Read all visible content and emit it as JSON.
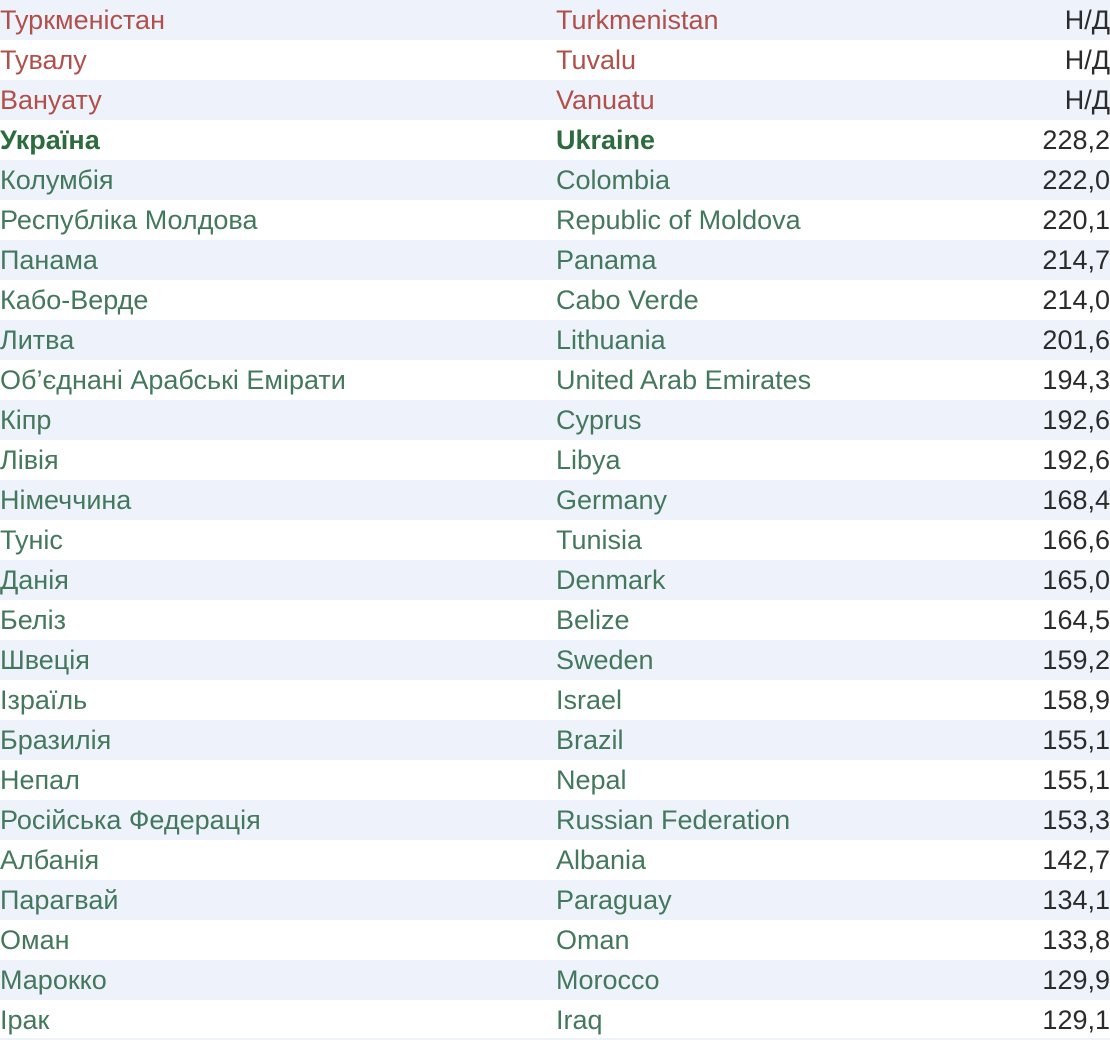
{
  "table": {
    "columns": {
      "name_uk": "",
      "name_en": "",
      "value": ""
    },
    "missing_value_label": "Н/Д",
    "colors": {
      "missing": "#b0504a",
      "normal": "#44785c",
      "highlight": "#2d6b3f",
      "value": "#2b2b2b",
      "stripe": "#eef3fb",
      "background": "#ffffff"
    },
    "rows": [
      {
        "name_uk": "Туркменістан",
        "name_en": "Turkmenistan",
        "value": "Н/Д",
        "state": "missing"
      },
      {
        "name_uk": "Тувалу",
        "name_en": "Tuvalu",
        "value": "Н/Д",
        "state": "missing"
      },
      {
        "name_uk": "Вануату",
        "name_en": "Vanuatu",
        "value": "Н/Д",
        "state": "missing"
      },
      {
        "name_uk": "Україна",
        "name_en": "Ukraine",
        "value": "228,2",
        "state": "highlight"
      },
      {
        "name_uk": "Колумбія",
        "name_en": "Colombia",
        "value": "222,0",
        "state": "normal"
      },
      {
        "name_uk": "Республіка Молдова",
        "name_en": "Republic of Moldova",
        "value": "220,1",
        "state": "normal"
      },
      {
        "name_uk": "Панама",
        "name_en": "Panama",
        "value": "214,7",
        "state": "normal"
      },
      {
        "name_uk": "Кабо-Верде",
        "name_en": "Cabo Verde",
        "value": "214,0",
        "state": "normal"
      },
      {
        "name_uk": "Литва",
        "name_en": "Lithuania",
        "value": "201,6",
        "state": "normal"
      },
      {
        "name_uk": "Об’єднані Арабські Емірати",
        "name_en": "United Arab Emirates",
        "value": "194,3",
        "state": "normal"
      },
      {
        "name_uk": "Кіпр",
        "name_en": "Cyprus",
        "value": "192,6",
        "state": "normal"
      },
      {
        "name_uk": "Лівія",
        "name_en": "Libya",
        "value": "192,6",
        "state": "normal"
      },
      {
        "name_uk": "Німеччина",
        "name_en": "Germany",
        "value": "168,4",
        "state": "normal"
      },
      {
        "name_uk": "Туніс",
        "name_en": "Tunisia",
        "value": "166,6",
        "state": "normal"
      },
      {
        "name_uk": "Данія",
        "name_en": "Denmark",
        "value": "165,0",
        "state": "normal"
      },
      {
        "name_uk": "Беліз",
        "name_en": "Belize",
        "value": "164,5",
        "state": "normal"
      },
      {
        "name_uk": "Швеція",
        "name_en": "Sweden",
        "value": "159,2",
        "state": "normal"
      },
      {
        "name_uk": "Ізраїль",
        "name_en": "Israel",
        "value": "158,9",
        "state": "normal"
      },
      {
        "name_uk": "Бразилія",
        "name_en": "Brazil",
        "value": "155,1",
        "state": "normal"
      },
      {
        "name_uk": "Непал",
        "name_en": "Nepal",
        "value": "155,1",
        "state": "normal"
      },
      {
        "name_uk": "Російська Федерація",
        "name_en": "Russian Federation",
        "value": "153,3",
        "state": "normal"
      },
      {
        "name_uk": "Албанія",
        "name_en": "Albania",
        "value": "142,7",
        "state": "normal"
      },
      {
        "name_uk": "Парагвай",
        "name_en": "Paraguay",
        "value": "134,1",
        "state": "normal"
      },
      {
        "name_uk": "Оман",
        "name_en": "Oman",
        "value": "133,8",
        "state": "normal"
      },
      {
        "name_uk": "Марокко",
        "name_en": "Morocco",
        "value": "129,9",
        "state": "normal"
      },
      {
        "name_uk": "Ірак",
        "name_en": "Iraq",
        "value": "129,1",
        "state": "normal"
      }
    ]
  }
}
